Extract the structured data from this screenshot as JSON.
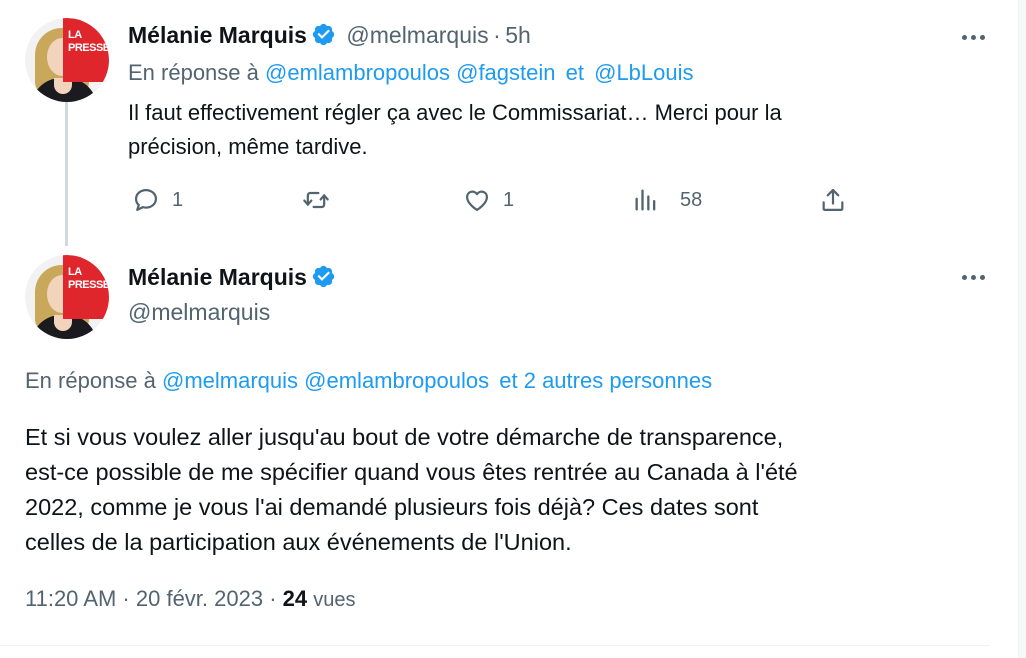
{
  "colors": {
    "link": "#1d9bf0",
    "muted": "#536471",
    "text": "#0f1419",
    "verified": "#1d9bf0",
    "brand": "#e0262d"
  },
  "reply_tweet": {
    "avatar_badge": [
      "LA",
      "PRESSE"
    ],
    "author_name": "Mélanie Marquis",
    "handle": "@melmarquis",
    "separator": "·",
    "time": "5h",
    "reply_to_prefix": "En réponse à",
    "reply_to_users": [
      "@emlambropoulos",
      "@fagstein"
    ],
    "reply_to_and": "et",
    "reply_to_last": "@LbLouis",
    "text_lines": [
      "Il faut effectivement régler ça avec le Commissariat… Merci pour la",
      "précision, même tardive."
    ],
    "actions": {
      "reply": {
        "icon": "reply-icon",
        "count": "1"
      },
      "retweet": {
        "icon": "retweet-icon",
        "count": ""
      },
      "like": {
        "icon": "heart-icon",
        "count": "1"
      },
      "views": {
        "icon": "views-icon",
        "count": "58"
      },
      "share": {
        "icon": "share-icon"
      }
    }
  },
  "main_tweet": {
    "avatar_badge": [
      "LA",
      "PRESSE"
    ],
    "author_name": "Mélanie Marquis",
    "handle": "@melmarquis",
    "reply_to_prefix": "En réponse à",
    "reply_to_users": [
      "@melmarquis",
      "@emlambropoulos"
    ],
    "reply_to_others": "et 2 autres personnes",
    "text_lines": [
      "Et si vous voulez aller jusqu'au bout de votre démarche de transparence,",
      "est-ce possible de me spécifier quand vous êtes rentrée au Canada à l'été",
      "2022, comme je vous l'ai demandé plusieurs fois déjà? Ces dates sont",
      "celles de la participation aux événements de l'Union."
    ],
    "timestamp": "11:20 AM · 20 févr. 2023 ·",
    "views_count": "24",
    "views_label": "vues"
  }
}
